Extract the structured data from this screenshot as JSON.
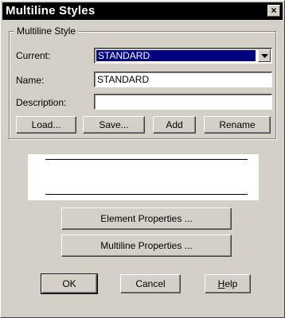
{
  "window": {
    "title": "Multiline Styles",
    "close_glyph": "×"
  },
  "group": {
    "label": "Multiline Style"
  },
  "fields": {
    "current_label": "Current:",
    "current_value": "STANDARD",
    "name_label": "Name:",
    "name_value": "STANDARD",
    "description_label": "Description:",
    "description_value": ""
  },
  "buttons": {
    "load": "Load...",
    "save": "Save...",
    "add": "Add",
    "rename": "Rename",
    "element_properties": "Element Properties ...",
    "multiline_properties": "Multiline Properties ...",
    "ok": "OK",
    "cancel": "Cancel",
    "help_first": "H",
    "help_rest": "elp"
  },
  "icons": {
    "combo_arrow": "chevron-down-icon",
    "close": "close-icon"
  },
  "colors": {
    "selection": "#000080",
    "dialog_bg": "#d4d0c8",
    "titlebar": "#000000"
  }
}
